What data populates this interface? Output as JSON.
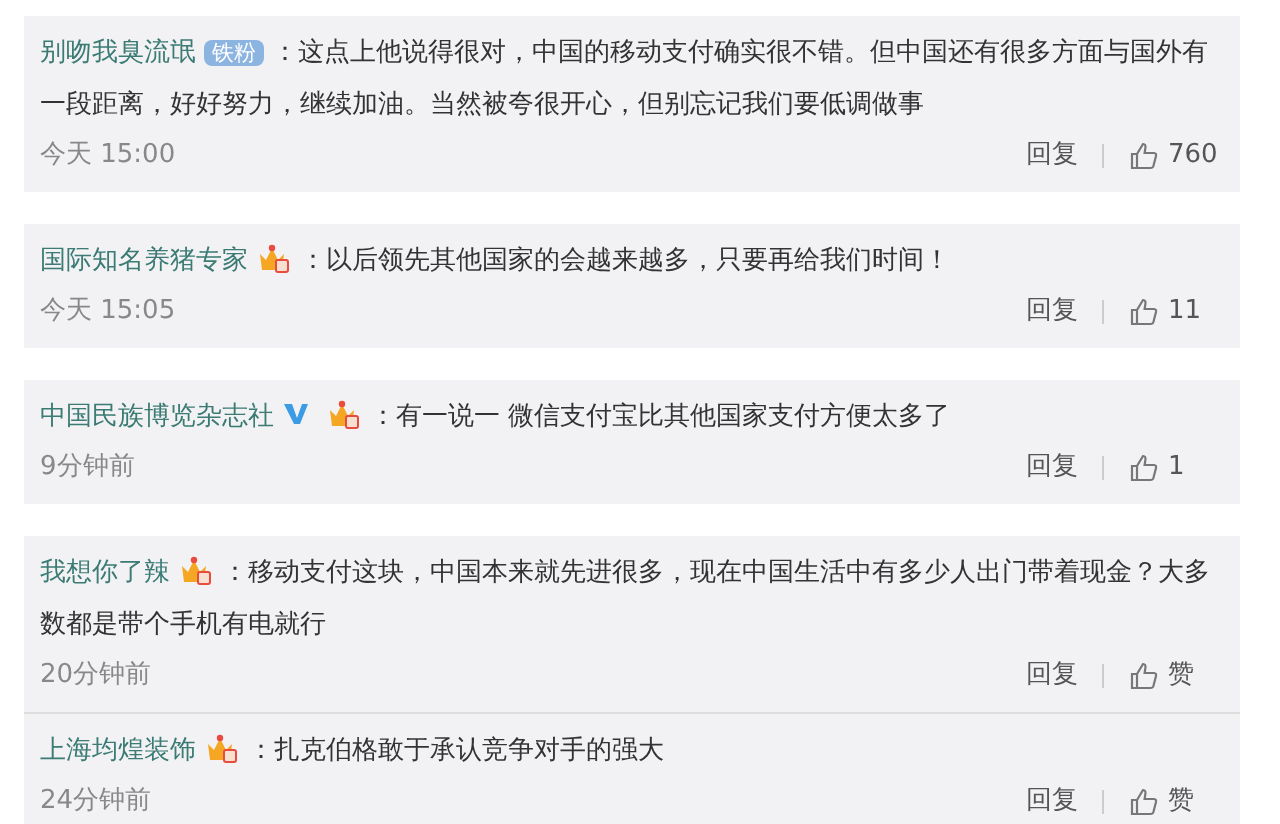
{
  "groups": [
    {
      "comments": [
        {
          "user": "别吻我臭流氓",
          "badges": [
            {
              "kind": "label",
              "text": "铁粉"
            }
          ],
          "text": "：这点上他说得很对，中国的移动支付确实很不错。但中国还有很多方面与国外有一段距离，好好努力，继续加油。当然被夸很开心，但别忘记我们要低调做事",
          "time": "今天 15:00",
          "reply": "回复",
          "likes": "760"
        }
      ]
    },
    {
      "comments": [
        {
          "user": "国际知名养猪专家",
          "badges": [
            {
              "kind": "vip"
            }
          ],
          "text": "：以后领先其他国家的会越来越多，只要再给我们时间！",
          "time": "今天 15:05",
          "reply": "回复",
          "likes": "11"
        }
      ]
    },
    {
      "comments": [
        {
          "user": "中国民族博览杂志社",
          "badges": [
            {
              "kind": "verified"
            },
            {
              "kind": "vip"
            }
          ],
          "text": "：有一说一 微信支付宝比其他国家支付方便太多了",
          "time": "9分钟前",
          "reply": "回复",
          "likes": "1"
        }
      ]
    },
    {
      "comments": [
        {
          "user": "我想你了辣",
          "badges": [
            {
              "kind": "vip"
            }
          ],
          "text": "：移动支付这块，中国本来就先进很多，现在中国生活中有多少人出门带着现金？大多数都是带个手机有电就行",
          "time": "20分钟前",
          "reply": "回复",
          "likes": "赞"
        },
        {
          "user": "上海均煌装饰",
          "badges": [
            {
              "kind": "vip"
            }
          ],
          "text": "：扎克伯格敢于承认竞争对手的强大",
          "time": "24分钟前",
          "reply": "回复",
          "likes": "赞"
        }
      ]
    }
  ]
}
